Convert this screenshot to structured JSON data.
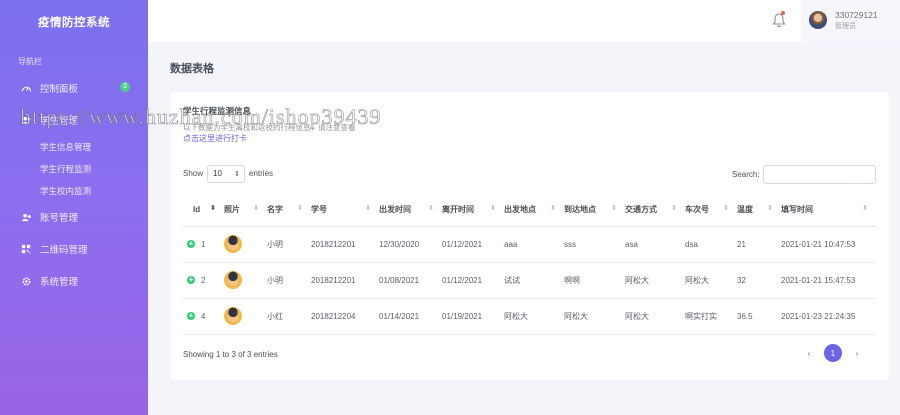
{
  "sidebar": {
    "brand": "疫情防控系统",
    "caption": "导航栏",
    "items": [
      {
        "label": "控制面板",
        "icon": "gauge-icon",
        "badge": "3"
      },
      {
        "label": "学生管理",
        "icon": "users-icon"
      },
      {
        "label": "账号管理",
        "icon": "account-icon"
      },
      {
        "label": "二维码管理",
        "icon": "qrcode-icon"
      },
      {
        "label": "系统管理",
        "icon": "settings-icon"
      }
    ],
    "sub_items": [
      "学生信息管理",
      "学生行程监测",
      "学生校内监测"
    ]
  },
  "header": {
    "user_name": "330729121",
    "user_role": "管理员"
  },
  "page": {
    "title": "数据表格"
  },
  "card": {
    "title": "学生行程监测信息",
    "subtitle": "以下数据为学生离校和返校的行程信息，请注意查看",
    "link": "点击这里进行打卡"
  },
  "table_controls": {
    "show_label": "Show",
    "length_value": "10",
    "entries_label": "entries",
    "search_label": "Search:",
    "search_value": ""
  },
  "table": {
    "headers": [
      "Id",
      "照片",
      "名字",
      "学号",
      "出发时间",
      "离开时间",
      "出发地点",
      "到达地点",
      "交通方式",
      "车次号",
      "温度",
      "填写时间"
    ],
    "rows": [
      {
        "id": "1",
        "name": "小明",
        "student_no": "2018212201",
        "depart_time": "12/30/2020",
        "leave_time": "01/12/2021",
        "depart_place": "aaa",
        "arrive_place": "sss",
        "transport": "asa",
        "train_no": "dsa",
        "temp": "21",
        "filled_at": "2021-01-21 10:47:53"
      },
      {
        "id": "2",
        "name": "小明",
        "student_no": "2018212201",
        "depart_time": "01/08/2021",
        "leave_time": "01/12/2021",
        "depart_place": "试试",
        "arrive_place": "啊啊",
        "transport": "阿松大",
        "train_no": "阿松大",
        "temp": "32",
        "filled_at": "2021-01-21 15:47:53"
      },
      {
        "id": "4",
        "name": "小红",
        "student_no": "2018212204",
        "depart_time": "01/14/2021",
        "leave_time": "01/19/2021",
        "depart_place": "阿松大",
        "arrive_place": "阿松大",
        "transport": "阿松大",
        "train_no": "啊实打实",
        "temp": "36.5",
        "filled_at": "2021-01-23 21:24:35"
      }
    ]
  },
  "footer": {
    "info": "Showing 1 to 3 of 3 entries",
    "prev": "‹",
    "current_page": "1",
    "next": "›"
  },
  "watermark": "https://www.huzhan.com/ishop39439",
  "colors": {
    "accent": "#6c63e6",
    "badge": "#4cd089",
    "expand": "#31ce77"
  }
}
